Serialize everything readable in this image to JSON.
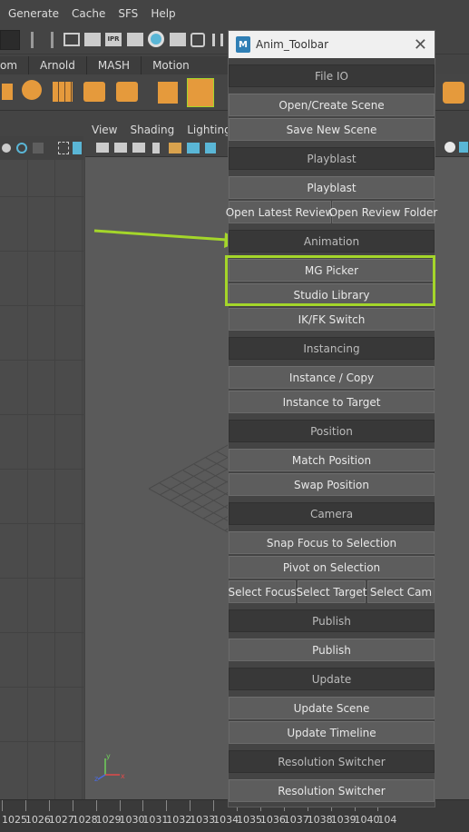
{
  "maya": {
    "menu": [
      "Generate",
      "Cache",
      "SFS",
      "Help"
    ],
    "shelf_tabs": [
      "om",
      "Arnold",
      "MASH",
      "Motion Graphics"
    ],
    "viewport_menu": [
      "View",
      "Shading",
      "Lighting"
    ],
    "timeline_numbers": [
      "1025",
      "1026",
      "1027",
      "1028",
      "1029",
      "1030",
      "1031",
      "1032",
      "1033",
      "1034",
      "1035",
      "1036",
      "1037",
      "1038",
      "1039",
      "1040",
      "104"
    ],
    "toolbar_ipr": "IPR"
  },
  "window": {
    "title": "Anim_Toolbar",
    "logo": "M",
    "close": "✕"
  },
  "panel": {
    "file_io": "File IO",
    "open_create_scene": "Open/Create Scene",
    "save_new_scene": "Save New Scene",
    "playblast_header": "Playblast",
    "playblast": "Playblast",
    "open_latest_review": "Open Latest Review",
    "open_review_folder": "Open Review Folder",
    "animation_header": "Animation",
    "mg_picker": "MG Picker",
    "studio_library": "Studio Library",
    "ikfk_switch": "IK/FK Switch",
    "instancing_header": "Instancing",
    "instance_copy": "Instance / Copy",
    "instance_to_target": "Instance to Target",
    "position_header": "Position",
    "match_position": "Match Position",
    "swap_position": "Swap Position",
    "camera_header": "Camera",
    "snap_focus": "Snap Focus to Selection",
    "pivot_on_selection": "Pivot on Selection",
    "select_focus": "Select Focus",
    "select_target": "Select Target",
    "select_cam": "Select Cam",
    "publish_header": "Publish",
    "publish": "Publish",
    "update_header": "Update",
    "update_scene": "Update Scene",
    "update_timeline": "Update Timeline",
    "resolution_header": "Resolution Switcher",
    "resolution_switcher": "Resolution Switcher"
  },
  "colors": {
    "highlight": "#a4d62a",
    "arrow": "#a4d62a"
  }
}
